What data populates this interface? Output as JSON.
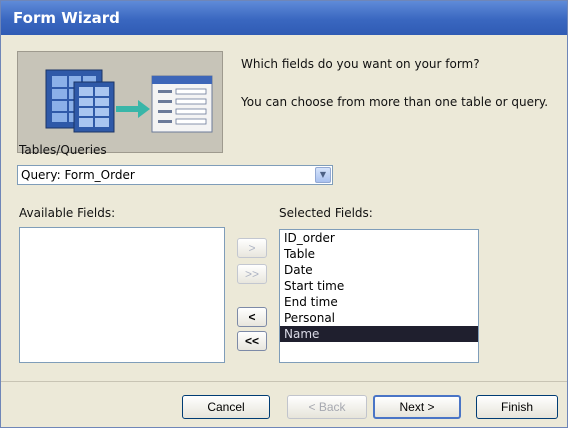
{
  "window": {
    "title": "Form Wizard"
  },
  "intro": {
    "question": "Which fields do you want on your form?",
    "hint": "You can choose from more than one table or query."
  },
  "tables_queries": {
    "label": "Tables/Queries",
    "value": "Query: Form_Order",
    "arrow": "▼"
  },
  "available_fields": {
    "label": "Available Fields:",
    "items": []
  },
  "selected_fields": {
    "label": "Selected Fields:",
    "items": [
      "ID_order",
      "Table",
      "Date",
      "Start time",
      "End time",
      "Personal",
      "Name"
    ],
    "selected_item": "Name"
  },
  "movers": {
    "add_one": ">",
    "add_all": ">>",
    "remove_one": "<",
    "remove_all": "<<"
  },
  "buttons": {
    "cancel": "Cancel",
    "back": "< Back",
    "next": "Next >",
    "finish": "Finish"
  },
  "icons": {
    "illustration": "table-to-form-illustration",
    "dropdown": "chevron-down-icon"
  },
  "colors": {
    "title_bar": "#3a67c0",
    "dialog_bg": "#ece9d8",
    "selection_bg": "#1f1f2e"
  }
}
